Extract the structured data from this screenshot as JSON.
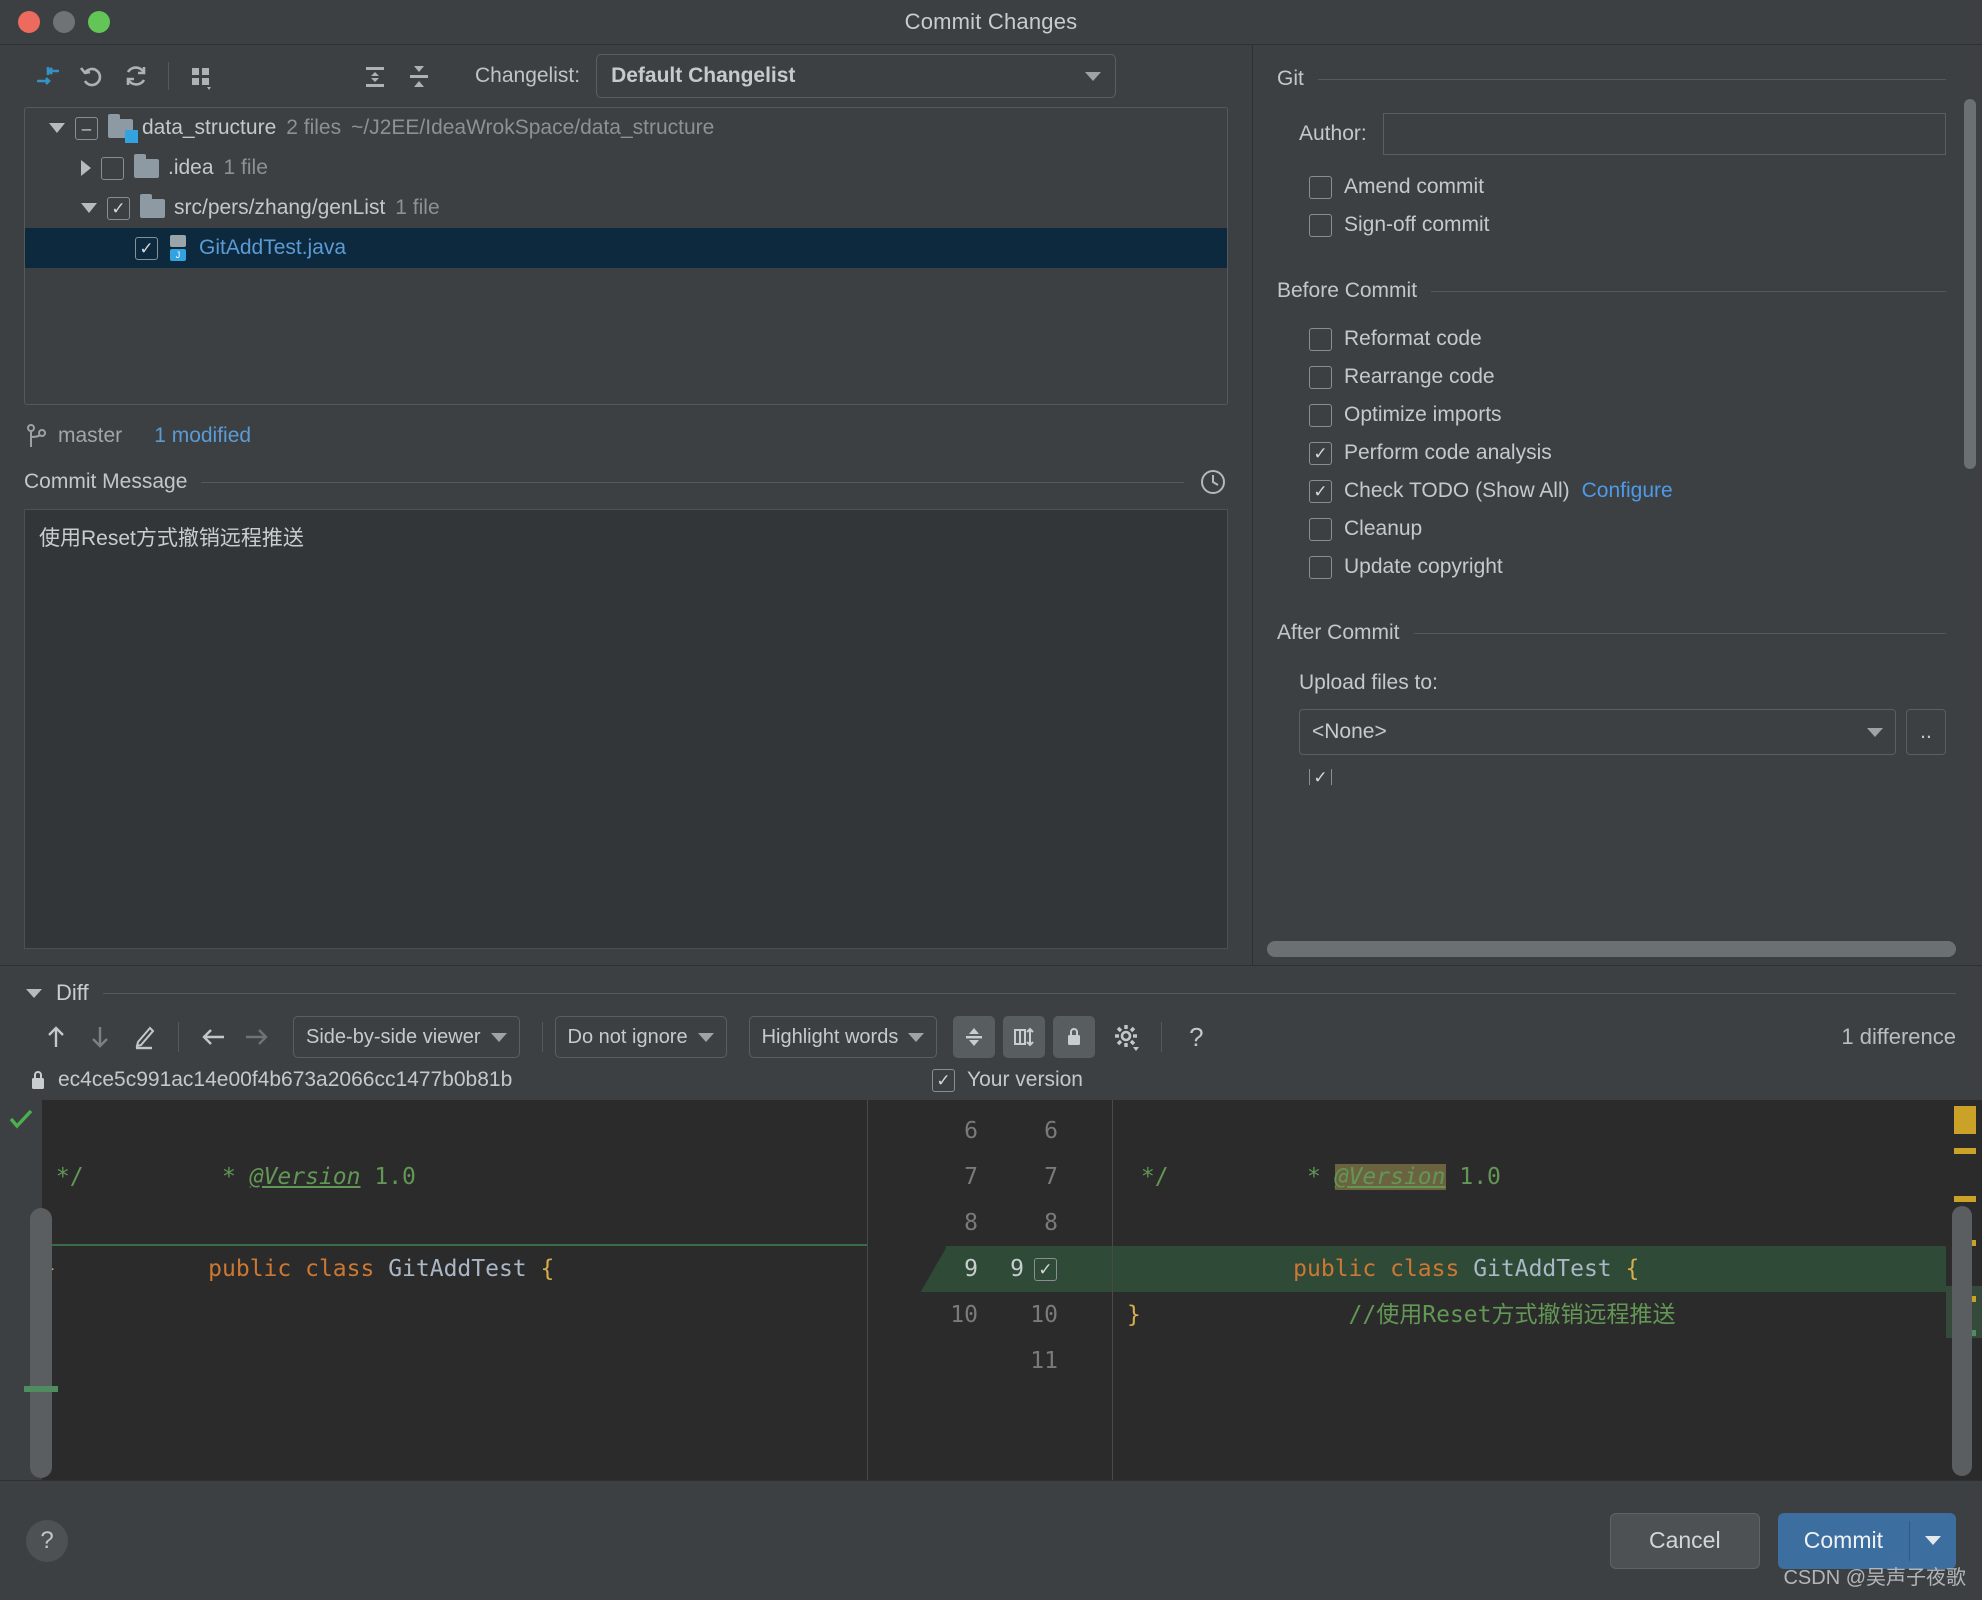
{
  "window": {
    "title": "Commit Changes"
  },
  "toolbar": {
    "icons": [
      "show-diff-icon",
      "revert-icon",
      "refresh-icon",
      "group-by-icon"
    ],
    "expand_all_icon": "expand-all-icon",
    "collapse_all_icon": "collapse-all-icon",
    "changelist_label": "Changelist:",
    "changelist_value": "Default Changelist"
  },
  "tree": {
    "rows": [
      {
        "name": "data_structure",
        "count": "2 files",
        "path": "~/J2EE/IdeaWrokSpace/data_structure",
        "state": "partial",
        "expanded": true,
        "indent": 0,
        "type": "folder",
        "selected": false
      },
      {
        "name": ".idea",
        "count": "1 file",
        "path": "",
        "state": "unchecked",
        "expanded": false,
        "indent": 1,
        "type": "folder",
        "selected": false
      },
      {
        "name": "src/pers/zhang/genList",
        "count": "1 file",
        "path": "",
        "state": "checked",
        "expanded": true,
        "indent": 1,
        "type": "folder",
        "selected": false
      },
      {
        "name": "GitAddTest.java",
        "count": "",
        "path": "",
        "state": "checked",
        "expanded": null,
        "indent": 2,
        "type": "java",
        "selected": true
      }
    ]
  },
  "branch": {
    "name": "master",
    "status": "1 modified",
    "icon": "branch-icon"
  },
  "commit_message": {
    "label": "Commit Message",
    "history_icon": "history-clock-icon",
    "value": "使用Reset方式撤销远程推送"
  },
  "git_section": {
    "title": "Git",
    "author_label": "Author:",
    "author_value": "",
    "options": [
      {
        "label": "Amend commit",
        "checked": false
      },
      {
        "label": "Sign-off commit",
        "checked": false
      }
    ]
  },
  "before_commit": {
    "title": "Before Commit",
    "options": [
      {
        "label": "Reformat code",
        "checked": false,
        "link": ""
      },
      {
        "label": "Rearrange code",
        "checked": false,
        "link": ""
      },
      {
        "label": "Optimize imports",
        "checked": false,
        "link": ""
      },
      {
        "label": "Perform code analysis",
        "checked": true,
        "link": ""
      },
      {
        "label": "Check TODO (Show All)",
        "checked": true,
        "link": "Configure"
      },
      {
        "label": "Cleanup",
        "checked": false,
        "link": ""
      },
      {
        "label": "Update copyright",
        "checked": false,
        "link": ""
      }
    ]
  },
  "after_commit": {
    "title": "After Commit",
    "upload_label": "Upload files to:",
    "upload_value": "<None>",
    "browse_label": ".."
  },
  "diff": {
    "title": "Diff",
    "toolbar": {
      "prev_icon": "arrow-up-icon",
      "next_icon": "arrow-down-icon",
      "edit_icon": "edit-pencil-icon",
      "apply_left_icon": "arrow-left-icon",
      "apply_right_icon": "arrow-right-icon",
      "viewer_mode": "Side-by-side viewer",
      "whitespace_mode": "Do not ignore",
      "highlight_mode": "Highlight words",
      "collapse_icon": "collapse-unchanged-icon",
      "align_icon": "align-columns-icon",
      "lock_icon": "lock-icon",
      "settings_icon": "gear-icon",
      "help_icon": "help-question-icon",
      "difference_count": "1 difference"
    },
    "left_revision": {
      "lock_icon": "lock-icon",
      "label": "ec4ce5c991ac14e00f4b673a2066cc1477b0b81b"
    },
    "right_revision": {
      "checked": true,
      "label": "Your version"
    },
    "left_lines": [
      {
        "num": "6",
        "text": " * @Version 1.0",
        "kind": "comment-version"
      },
      {
        "num": "7",
        "text": " */",
        "kind": "comment"
      },
      {
        "num": "8",
        "text": "public class GitAddTest {",
        "kind": "code"
      },
      {
        "num": "9",
        "text": "}",
        "kind": "brace"
      }
    ],
    "right_lines": [
      {
        "num": "6",
        "text": " * @Version 1.0",
        "kind": "comment-version",
        "added": false
      },
      {
        "num": "7",
        "text": " */",
        "kind": "comment",
        "added": false
      },
      {
        "num": "8",
        "text": "public class GitAddTest {",
        "kind": "code",
        "added": false
      },
      {
        "num": "9",
        "text": "    //使用Reset方式撤销远程推送",
        "kind": "comment",
        "added": true
      },
      {
        "num": "10",
        "text": "}",
        "kind": "brace",
        "added": false
      },
      {
        "num": "11",
        "text": "",
        "kind": "blank",
        "added": false
      }
    ],
    "mid_left_nums": [
      "6",
      "7",
      "8",
      "9",
      "10"
    ],
    "mid_right_nums": [
      "6",
      "7",
      "8",
      "9",
      "10",
      "11"
    ],
    "accept_checkbox_line": "9"
  },
  "bottom": {
    "help_icon": "help-question-icon",
    "cancel_label": "Cancel",
    "commit_label": "Commit",
    "commit_dropdown_icon": "chevron-down-icon"
  },
  "watermark": "CSDN @吴声子夜歌",
  "colors": {
    "accent": "#3c6e9f",
    "link": "#4d9ae8",
    "added": "#2f4a37",
    "marker": "#c9a227"
  }
}
